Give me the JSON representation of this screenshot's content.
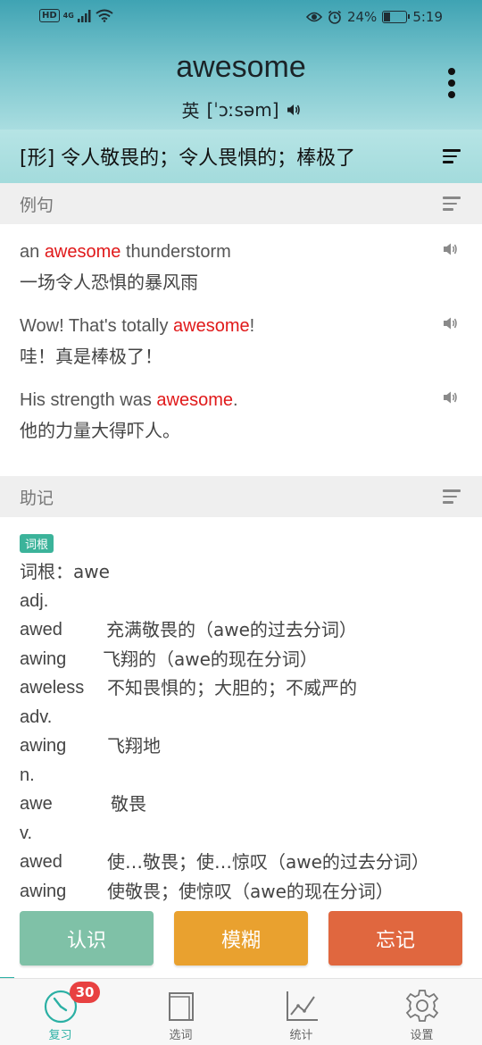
{
  "status": {
    "hd": "HD",
    "net": "4G",
    "battery_pct_text": "24%",
    "battery_level": 0.24,
    "time": "5:19"
  },
  "word": {
    "title": "awesome",
    "accent_label": "英",
    "phonetic": "[ˈɔːsəm]"
  },
  "definition": "[形] 令人敬畏的；令人畏惧的；棒极了",
  "examples_section": {
    "title": "例句",
    "items": [
      {
        "pre": "an ",
        "hl": "awesome",
        "post": " thunderstorm",
        "cn": "一场令人恐惧的暴风雨"
      },
      {
        "pre": "Wow! That's totally ",
        "hl": "awesome",
        "post": "!",
        "cn": "哇！真是棒极了！"
      },
      {
        "pre": "His strength was ",
        "hl": "awesome",
        "post": ".",
        "cn": "他的力量大得吓人。"
      }
    ]
  },
  "memory_section": {
    "title": "助记",
    "tag": "词根",
    "lines": [
      {
        "w": "词根：awe",
        "d": ""
      },
      {
        "w": "adj.",
        "d": ""
      },
      {
        "w": "awed",
        "d": "充满敬畏的（awe的过去分词）"
      },
      {
        "w": "awing",
        "d": "飞翔的（awe的现在分词）"
      },
      {
        "w": "aweless",
        "d": "不知畏惧的；大胆的；不威严的"
      },
      {
        "w": "adv.",
        "d": ""
      },
      {
        "w": "awing",
        "d": "飞翔地"
      },
      {
        "w": "n.",
        "d": ""
      },
      {
        "w": "awe",
        "d": "敬畏"
      },
      {
        "w": "v.",
        "d": ""
      },
      {
        "w": "awed",
        "d": "使…敬畏；使…惊叹（awe的过去分词）"
      },
      {
        "w": "awing",
        "d": "使敬畏；使惊叹（awe的现在分词）"
      }
    ]
  },
  "actions": {
    "know": "认识",
    "vague": "模糊",
    "forget": "忘记"
  },
  "tabs": {
    "review": "复习",
    "review_badge": "30",
    "select": "选词",
    "stats": "统计",
    "settings": "设置"
  },
  "colors": {
    "accent": "#2bb0a4",
    "highlight": "#e0191a",
    "know": "#7fc1a7",
    "vague": "#e9a12f",
    "forget": "#e0673f"
  }
}
